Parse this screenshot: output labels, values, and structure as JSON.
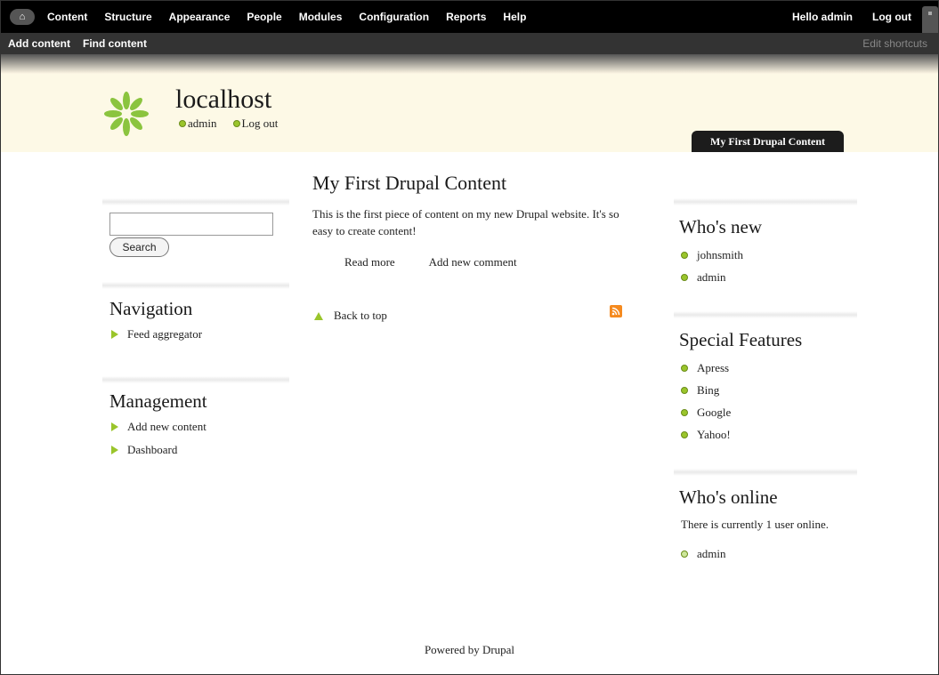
{
  "toolbar": {
    "menu": [
      "Content",
      "Structure",
      "Appearance",
      "People",
      "Modules",
      "Configuration",
      "Reports",
      "Help"
    ],
    "hello_prefix": "Hello ",
    "hello_user": "admin",
    "logout": "Log out",
    "shortcuts": [
      "Add content",
      "Find content"
    ],
    "edit_shortcuts": "Edit shortcuts"
  },
  "header": {
    "site_name": "localhost",
    "user_links": [
      "admin",
      "Log out"
    ],
    "primary_tab": "My First Drupal Content"
  },
  "sidebar_first": {
    "search_button": "Search",
    "navigation": {
      "title": "Navigation",
      "items": [
        "Feed aggregator"
      ]
    },
    "management": {
      "title": "Management",
      "items": [
        "Add new content",
        "Dashboard"
      ]
    }
  },
  "content": {
    "title": "My First Drupal Content",
    "body": "This is the first piece of content on my new Drupal website. It's so easy to create content!",
    "links": [
      "Read more",
      "Add new comment"
    ],
    "back_to_top": "Back to top"
  },
  "sidebar_second": {
    "whos_new": {
      "title": "Who's new",
      "users": [
        "johnsmith",
        "admin"
      ]
    },
    "special_features": {
      "title": "Special Features",
      "items": [
        "Apress",
        "Bing",
        "Google",
        "Yahoo!"
      ]
    },
    "whos_online": {
      "title": "Who's online",
      "text": "There is currently 1 user online.",
      "users": [
        "admin"
      ]
    }
  },
  "footer": {
    "text": "Powered by Drupal"
  },
  "colors": {
    "accent_green": "#9ac52b",
    "toolbar_bg": "#000000",
    "header_bg": "#fdf9e6",
    "rss_orange": "#f58a1f"
  }
}
